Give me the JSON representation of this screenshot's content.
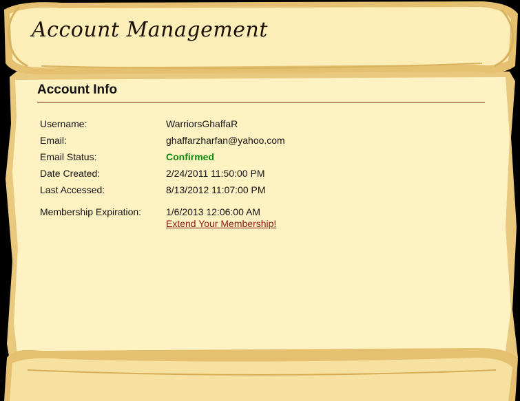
{
  "banner": {
    "title": "Account Management"
  },
  "section": {
    "title": "Account Info"
  },
  "rows": [
    {
      "label": "Username:",
      "value": "WarriorsGhaffaR"
    },
    {
      "label": "Email:",
      "value": "ghaffarzharfan@yahoo.com"
    },
    {
      "label": "Email Status:",
      "value": "Confirmed"
    },
    {
      "label": "Date Created:",
      "value": "2/24/2011 11:50:00 PM"
    },
    {
      "label": "Last Accessed:",
      "value": "8/13/2012 11:07:00 PM"
    },
    {
      "label": "Membership Expiration:",
      "value": "1/6/2013 12:06:00 AM"
    }
  ],
  "links": {
    "extend_membership": "Extend Your Membership!"
  },
  "colors": {
    "parchment": "#FEF2C3",
    "parchment_edge": "#E8C77A",
    "confirmed": "#118811",
    "link": "#8B1A12",
    "rule": "#7A1E12"
  }
}
